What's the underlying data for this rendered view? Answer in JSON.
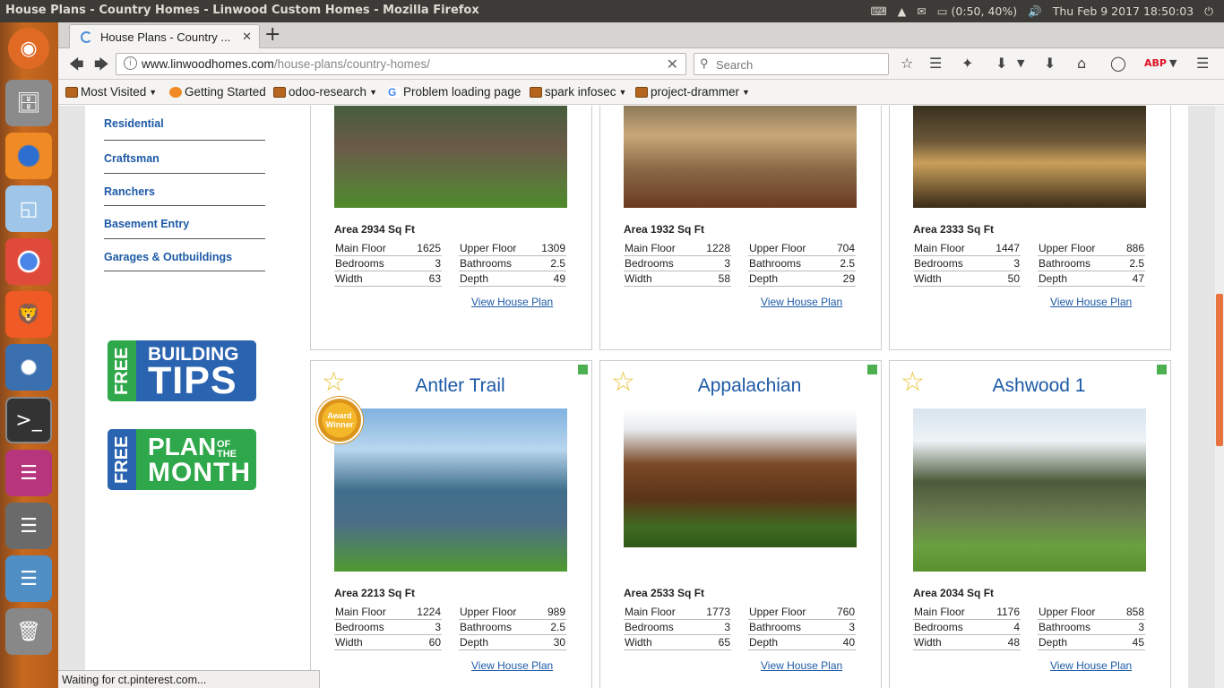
{
  "system": {
    "window_title": "House Plans - Country Homes - Linwood Custom Homes - Mozilla Firefox",
    "battery": "(0:50, 40%)",
    "clock": "Thu Feb  9 2017 18:50:03"
  },
  "browser": {
    "tab_title": "House Plans - Country ...",
    "url_host": "www.linwoodhomes.com",
    "url_path": "/house-plans/country-homes/",
    "search_placeholder": "Search",
    "bookmarks": [
      "Most Visited",
      "Getting Started",
      "odoo-research",
      "Problem loading page",
      "spark infosec",
      "project-drammer"
    ],
    "status_text": "Waiting for ct.pinterest.com..."
  },
  "sidebar": {
    "links": [
      "Residential",
      "Craftsman",
      "Ranchers",
      "Basement Entry",
      "Garages & Outbuildings"
    ]
  },
  "promos": {
    "tips_free": "FREE",
    "tips_line1": "BUILDING",
    "tips_line2": "TIPS",
    "month_free": "FREE",
    "month_line1": "PLAN",
    "month_of": "OF THE",
    "month_line2": "MONTH"
  },
  "labels": {
    "main": "Main Floor",
    "upper": "Upper Floor",
    "bed": "Bedrooms",
    "bath": "Bathrooms",
    "width": "Width",
    "depth": "Depth",
    "view": "View House Plan",
    "award": "Award Winner"
  },
  "plans": [
    {
      "name": "",
      "area": "Area 2934 Sq Ft",
      "main": "1625",
      "upper": "1309",
      "bed": "3",
      "bath": "2.5",
      "width": "63",
      "depth": "49"
    },
    {
      "name": "",
      "area": "Area 1932 Sq Ft",
      "main": "1228",
      "upper": "704",
      "bed": "3",
      "bath": "2.5",
      "width": "58",
      "depth": "29"
    },
    {
      "name": "",
      "area": "Area 2333 Sq Ft",
      "main": "1447",
      "upper": "886",
      "bed": "3",
      "bath": "2.5",
      "width": "50",
      "depth": "47"
    },
    {
      "name": "Antler Trail",
      "area": "Area 2213 Sq Ft",
      "main": "1224",
      "upper": "989",
      "bed": "3",
      "bath": "2.5",
      "width": "60",
      "depth": "30"
    },
    {
      "name": "Appalachian",
      "area": "Area 2533 Sq Ft",
      "main": "1773",
      "upper": "760",
      "bed": "3",
      "bath": "3",
      "width": "65",
      "depth": "40"
    },
    {
      "name": "Ashwood 1",
      "area": "Area 2034 Sq Ft",
      "main": "1176",
      "upper": "858",
      "bed": "4",
      "bath": "3",
      "width": "48",
      "depth": "45"
    }
  ]
}
